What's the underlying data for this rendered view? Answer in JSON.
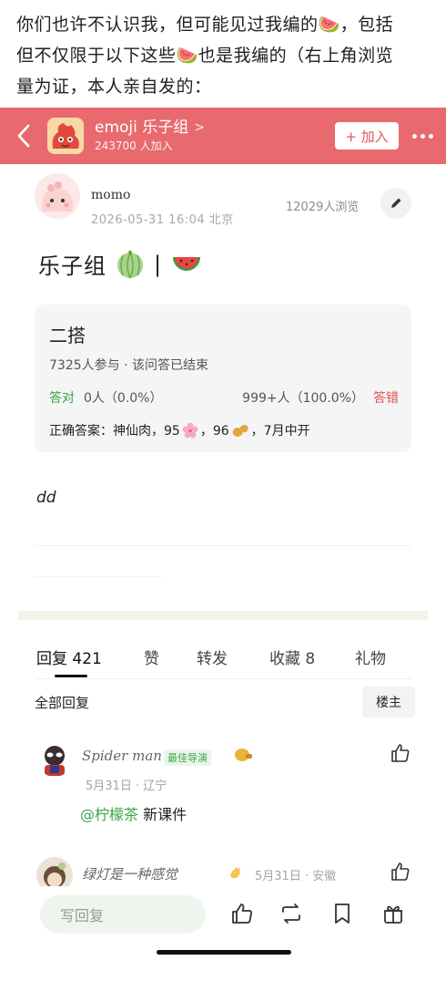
{
  "caption": {
    "line1": "你们也许不认识我，但可能见过我编的🍉，包括",
    "line2": "但不仅限于以下这些🍉也是我编的（右上角浏览",
    "line3": "量为证，本人亲自发的："
  },
  "group": {
    "name": "emoji 乐子组",
    "chevron": ">",
    "members": "243700 人加入",
    "join_label": "+ 加入"
  },
  "post": {
    "author": "momo",
    "date": "2026-05-31 16:04 北京",
    "views": "12029人浏览",
    "title_text": "乐子组",
    "title_sep": "|",
    "body": "dd"
  },
  "quiz": {
    "title": "二搭",
    "meta": "7325人参与 · 该问答已结束",
    "right_label": "答对",
    "right_value": "0人（0.0%）",
    "wrong_value": "999+人（100.0%）",
    "wrong_label": "答错",
    "answer_prefix": "正确答案：神仙肉，95",
    "answer_mid": "，96",
    "answer_suffix": "，7月中开"
  },
  "tabs": {
    "reply": "回复 421",
    "like": "赞",
    "share": "转发",
    "fav": "收藏 8",
    "gift": "礼物"
  },
  "replies": {
    "all_label": "全部回复",
    "owner_label": "楼主"
  },
  "comments": [
    {
      "name": "Spider man",
      "badge": "最佳导演",
      "date": "5月31日 · 辽宁",
      "mention": "@柠檬茶",
      "text": "新课件"
    },
    {
      "name": "绿灯是一种感觉",
      "date": "5月31日 · 安徽"
    }
  ],
  "bottom": {
    "reply_placeholder": "写回复"
  },
  "colors": {
    "group_bar": "#e86a6e",
    "accent_green": "#3aa545",
    "wrong_red": "#d9534f"
  }
}
